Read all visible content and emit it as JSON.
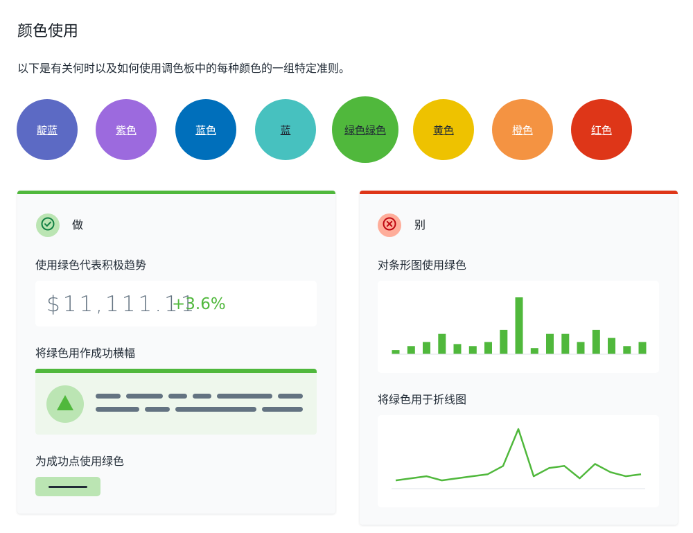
{
  "header": {
    "title": "颜色使用",
    "description": "以下是有关何时以及如何使用调色板中的每种颜色的一组特定准则。"
  },
  "swatches": [
    {
      "label": "靛蓝",
      "color": "#5c6ac4",
      "text_color": "#ffffff"
    },
    {
      "label": "紫色",
      "color": "#9c6ade",
      "text_color": "#ffffff"
    },
    {
      "label": "蓝色",
      "color": "#006fbb",
      "text_color": "#ffffff"
    },
    {
      "label": "蓝",
      "color": "#47c1bf",
      "text_color": "#212b36"
    },
    {
      "label": "绿色绿色",
      "color": "#50b83c",
      "text_color": "#212b36"
    },
    {
      "label": "黄色",
      "color": "#eec200",
      "text_color": "#212b36"
    },
    {
      "label": "橙色",
      "color": "#f49342",
      "text_color": "#ffffff"
    },
    {
      "label": "红色",
      "color": "#de3618",
      "text_color": "#ffffff"
    }
  ],
  "do_card": {
    "heading": "做",
    "accent": "#50b83c",
    "trend_label": "使用绿色代表积极趋势",
    "trend_value": "$11,111.11",
    "trend_delta": "+3.6%",
    "banner_label": "将绿色用作成功横幅",
    "button_label": "为成功点使用绿色"
  },
  "dont_card": {
    "heading": "别",
    "accent": "#de3618",
    "bar_label": "对条形图使用绿色",
    "line_label": "将绿色用于折线图"
  },
  "chart_data": [
    {
      "type": "bar",
      "values": [
        1,
        2,
        3,
        5,
        2.5,
        2,
        3,
        6,
        14,
        1.5,
        5,
        5,
        3,
        6,
        4,
        2,
        3
      ]
    },
    {
      "type": "line",
      "values": [
        2,
        3,
        4,
        2,
        3,
        4,
        5,
        9,
        27,
        4,
        8,
        9,
        3,
        10,
        6,
        4,
        5
      ]
    }
  ]
}
